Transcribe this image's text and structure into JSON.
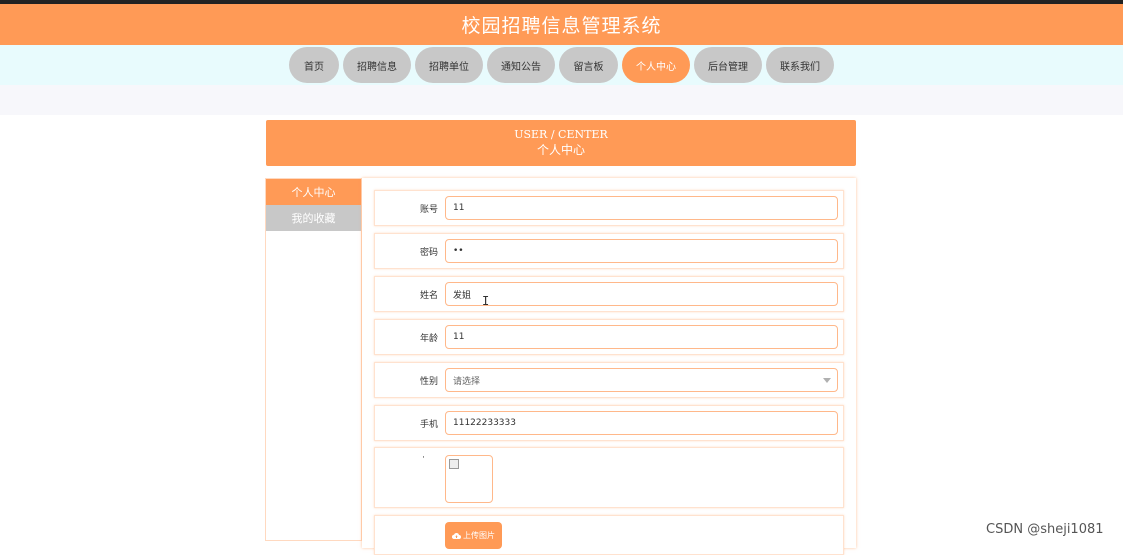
{
  "header": {
    "title": "校园招聘信息管理系统"
  },
  "nav": {
    "items": [
      {
        "label": "首页",
        "active": false
      },
      {
        "label": "招聘信息",
        "active": false
      },
      {
        "label": "招聘单位",
        "active": false
      },
      {
        "label": "通知公告",
        "active": false
      },
      {
        "label": "留言板",
        "active": false
      },
      {
        "label": "个人中心",
        "active": true
      },
      {
        "label": "后台管理",
        "active": false
      },
      {
        "label": "联系我们",
        "active": false
      }
    ]
  },
  "banner": {
    "title_en": "USER / CENTER",
    "title_cn": "个人中心"
  },
  "sidebar": {
    "items": [
      {
        "label": "个人中心",
        "active": true
      },
      {
        "label": "我的收藏",
        "active": false
      }
    ]
  },
  "form": {
    "account": {
      "label": "账号",
      "value": "11"
    },
    "password": {
      "label": "密码",
      "value": "••"
    },
    "name": {
      "label": "姓名",
      "value": "发姐"
    },
    "age": {
      "label": "年龄",
      "value": "11"
    },
    "gender": {
      "label": "性别",
      "value": "请选择"
    },
    "phone": {
      "label": "手机",
      "value": "11122233333"
    },
    "photo": {
      "label": "·"
    },
    "upload": {
      "label": "上传图片",
      "icon": "cloud-upload-icon"
    }
  },
  "watermark": {
    "text": "CSDN @sheji1081"
  },
  "colors": {
    "accent": "#ff9a56",
    "nav_inactive": "#c8c8c8",
    "nav_band": "#e8fbfd",
    "input_border": "#ffb88a"
  }
}
